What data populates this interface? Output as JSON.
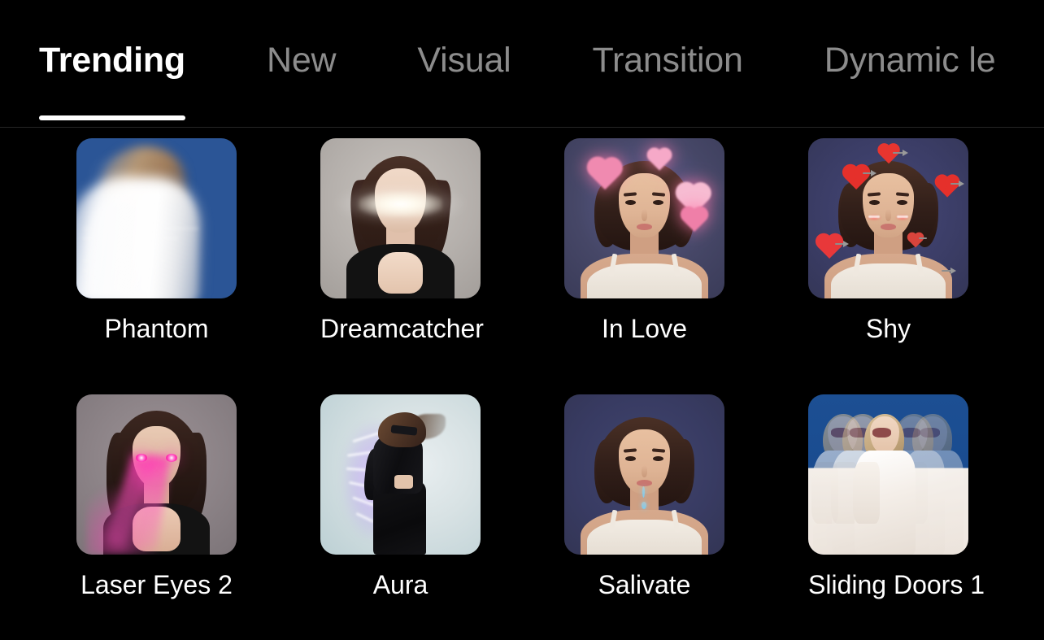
{
  "theme": {
    "background": "#000000",
    "active_tab_color": "#ffffff",
    "inactive_tab_color": "#8c8c8c",
    "divider_color": "#262626"
  },
  "tabs": [
    {
      "label": "Trending",
      "active": true
    },
    {
      "label": "New",
      "active": false
    },
    {
      "label": "Visual",
      "active": false
    },
    {
      "label": "Transition",
      "active": false
    },
    {
      "label": "Dynamic le",
      "active": false
    }
  ],
  "grid": {
    "columns": 4,
    "rows": [
      {
        "items": [
          {
            "label": "Phantom",
            "icon": "effect-thumbnail-phantom"
          },
          {
            "label": "Dreamcatcher",
            "icon": "effect-thumbnail-dreamcatcher"
          },
          {
            "label": "In Love",
            "icon": "effect-thumbnail-in-love"
          },
          {
            "label": "Shy",
            "icon": "effect-thumbnail-shy"
          }
        ]
      },
      {
        "items": [
          {
            "label": "Laser Eyes 2",
            "icon": "effect-thumbnail-laser-eyes-2"
          },
          {
            "label": "Aura",
            "icon": "effect-thumbnail-aura"
          },
          {
            "label": "Salivate",
            "icon": "effect-thumbnail-salivate"
          },
          {
            "label": "Sliding Doors 1",
            "icon": "effect-thumbnail-sliding-doors-1"
          }
        ]
      }
    ]
  }
}
